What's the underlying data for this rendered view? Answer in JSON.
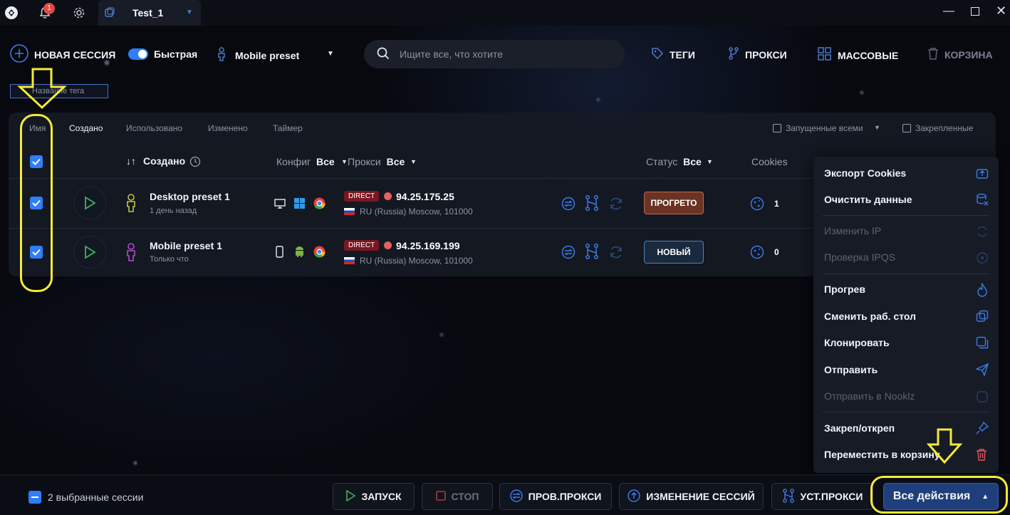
{
  "titlebar": {
    "notification_count": "1",
    "tab_title": "Test_1"
  },
  "toolbar": {
    "new_session": "НОВАЯ СЕССИЯ",
    "quick_label": "Быстрая",
    "preset": "Mobile preset",
    "search_placeholder": "Ищите все, что хотите",
    "tags": "ТЕГИ",
    "proxies": "ПРОКСИ",
    "bulk": "МАССОВЫЕ",
    "trash": "КОРЗИНА"
  },
  "tag_filter": {
    "placeholder": "Название тега"
  },
  "sort_tabs": [
    {
      "label": "Имя"
    },
    {
      "label": "Создано"
    },
    {
      "label": "Использовано"
    },
    {
      "label": "Изменено"
    },
    {
      "label": "Таймер"
    }
  ],
  "filters": {
    "launched_all": "Запущенные всеми",
    "pinned": "Закрепленные"
  },
  "table": {
    "created": "Создано",
    "config": "Конфиг",
    "config_value": "Все",
    "proxy": "Прокси",
    "proxy_value": "Все",
    "status": "Статус",
    "status_value": "Все",
    "cookies": "Cookies"
  },
  "rows": [
    {
      "name": "Desktop preset 1",
      "time": "1 день назад",
      "proxy_type": "DIRECT",
      "ip": "94.25.175.25",
      "location": "RU (Russia) Moscow, 101000",
      "status": "ПРОГРЕТО",
      "cookies": "1",
      "status_color": "#6b3324"
    },
    {
      "name": "Mobile preset 1",
      "time": "Только что",
      "proxy_type": "DIRECT",
      "ip": "94.25.169.199",
      "location": "RU (Russia) Moscow, 101000",
      "status": "НОВЫЙ",
      "cookies": "0",
      "status_color": "#1a2a3e"
    }
  ],
  "menu": {
    "export_cookies": "Экспорт Cookies",
    "clear_data": "Очистить данные",
    "change_ip": "Изменить IP",
    "check_ipqs": "Проверка IPQS",
    "warmup": "Прогрев",
    "change_desktop": "Сменить раб. стол",
    "clone": "Клонировать",
    "send": "Отправить",
    "send_nooklz": "Отправить в Nooklz",
    "pin": "Закреп/откреп",
    "move_trash": "Переместить в корзину"
  },
  "bottom": {
    "selected": "2 выбранные сессии",
    "launch": "ЗАПУСК",
    "stop": "СТОП",
    "check_proxy": "ПРОВ.ПРОКСИ",
    "change_sessions": "ИЗМЕНЕНИЕ СЕССИЙ",
    "set_proxy": "УСТ.ПРОКСИ",
    "all_actions": "Все действия"
  },
  "colors": {
    "accent": "#2f7ef7",
    "annotation": "#f4ea38",
    "direct_badge": "#7a1722"
  }
}
